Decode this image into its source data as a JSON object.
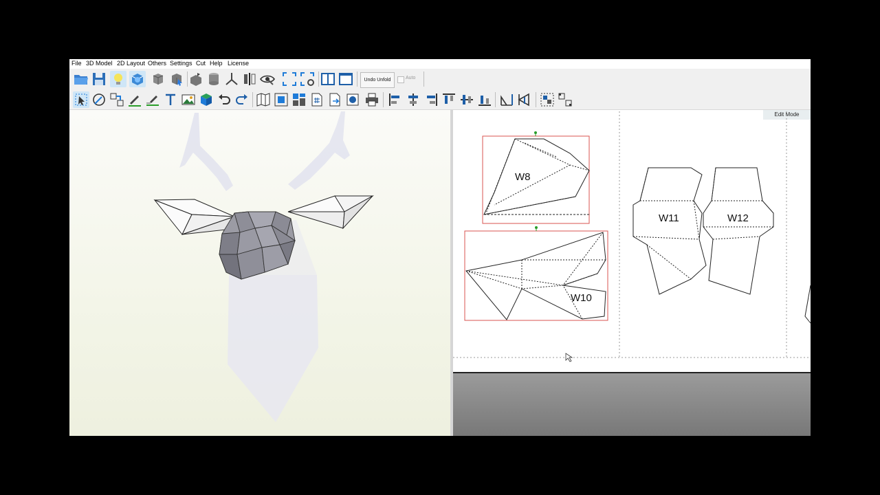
{
  "menu": [
    "File",
    "3D Model",
    "2D Layout",
    "Others",
    "Settings",
    "Cut",
    "Help",
    "License"
  ],
  "toolbar": {
    "undo_unfold": "Undo Unfold",
    "auto_label": "Auto",
    "auto_checked": true
  },
  "view2d": {
    "mode_label": "Edit Mode",
    "parts": [
      {
        "label": "W8"
      },
      {
        "label": "W10"
      },
      {
        "label": "W11"
      },
      {
        "label": "W12"
      }
    ]
  },
  "icons": {
    "toolbar1": [
      "open-folder-icon",
      "save-icon",
      "lightbulb-icon",
      "3d-view-icon",
      "cube-grey-icon",
      "cube-select-icon",
      "cube-flat-icon",
      "cylinder-icon",
      "axes-icon",
      "mirror-icon",
      "eye-icon",
      "fit-view-icon",
      "settings-view-icon",
      "split-view-icon",
      "single-view-icon"
    ],
    "toolbar2": [
      "select-arrow-icon",
      "rotate-icon",
      "join-parts-icon",
      "pencil-line-icon",
      "edit-line-icon",
      "text-icon",
      "image-icon",
      "cube-color-icon",
      "undo-icon",
      "redo-icon",
      "unfold-map-icon",
      "fit-page-icon",
      "arrange-icon",
      "page-number-icon",
      "export-page-icon",
      "paper-icon",
      "print-icon",
      "align-left-icon",
      "align-center-icon",
      "align-right-icon",
      "align-top-icon",
      "align-middle-icon",
      "align-bottom-icon",
      "flip-h-icon",
      "flip-v-icon",
      "group-icon",
      "ungroup-icon"
    ]
  },
  "colors": {
    "accent": "#1e7bd8",
    "part_border": "#d9534f",
    "tab_green": "#2a9d2a"
  }
}
